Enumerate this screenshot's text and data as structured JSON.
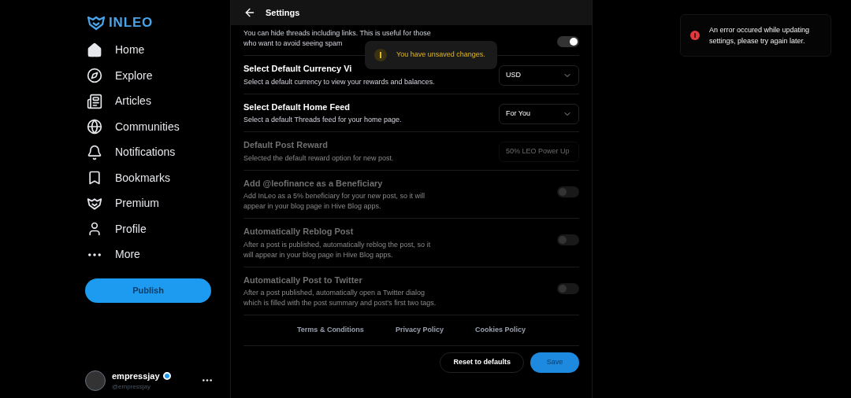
{
  "logo": "INLEO",
  "nav": [
    {
      "label": "Home"
    },
    {
      "label": "Explore"
    },
    {
      "label": "Articles"
    },
    {
      "label": "Communities"
    },
    {
      "label": "Notifications"
    },
    {
      "label": "Bookmarks"
    },
    {
      "label": "Premium"
    },
    {
      "label": "Profile"
    },
    {
      "label": "More"
    }
  ],
  "publish_button": "Publish",
  "account": {
    "name": "empressjay",
    "handle": "@empressjay",
    "verified": true
  },
  "header": {
    "title": "Settings"
  },
  "settings": [
    {
      "kind": "toggle",
      "description": "You can hide threads including links. This is useful for those who want to avoid seeing spam",
      "on": true,
      "disabled": false
    },
    {
      "kind": "select",
      "title": "Select Default Currency Vi",
      "description": "Select a default currency to view your rewards and balances.",
      "value": "USD",
      "disabled": false
    },
    {
      "kind": "select",
      "title": "Select Default Home Feed",
      "description": "Select a default Threads feed for your home page.",
      "value": "For You",
      "disabled": false
    },
    {
      "kind": "select",
      "title": "Default Post Reward",
      "description": "Selected the default reward option for new post.",
      "value": "50% LEO Power Up",
      "disabled": true
    },
    {
      "kind": "toggle",
      "title": "Add @leofinance as a Beneficiary",
      "description": "Add InLeo as a 5% beneficiary for your new post, so it will appear in your blog page in Hive Blog apps.",
      "on": false,
      "disabled": true
    },
    {
      "kind": "toggle",
      "title": "Automatically Reblog Post",
      "description": "After a post is published, automatically reblog the post, so it will appear in your blog page in Hive Blog apps.",
      "on": false,
      "disabled": true
    },
    {
      "kind": "toggle",
      "title": "Automatically Post to Twitter",
      "description": "After a post published, automatically open a Twitter dialog which is filled with the post summary and post's first two tags.",
      "on": false,
      "disabled": true
    }
  ],
  "footer_links": [
    "Terms & Conditions",
    "Privacy Policy",
    "Cookies Policy"
  ],
  "actions": {
    "reset": "Reset to defaults",
    "save": "Save"
  },
  "warning_toast": "You have unsaved changes.",
  "error_toast": "An error occured while updating settings, please try again later."
}
